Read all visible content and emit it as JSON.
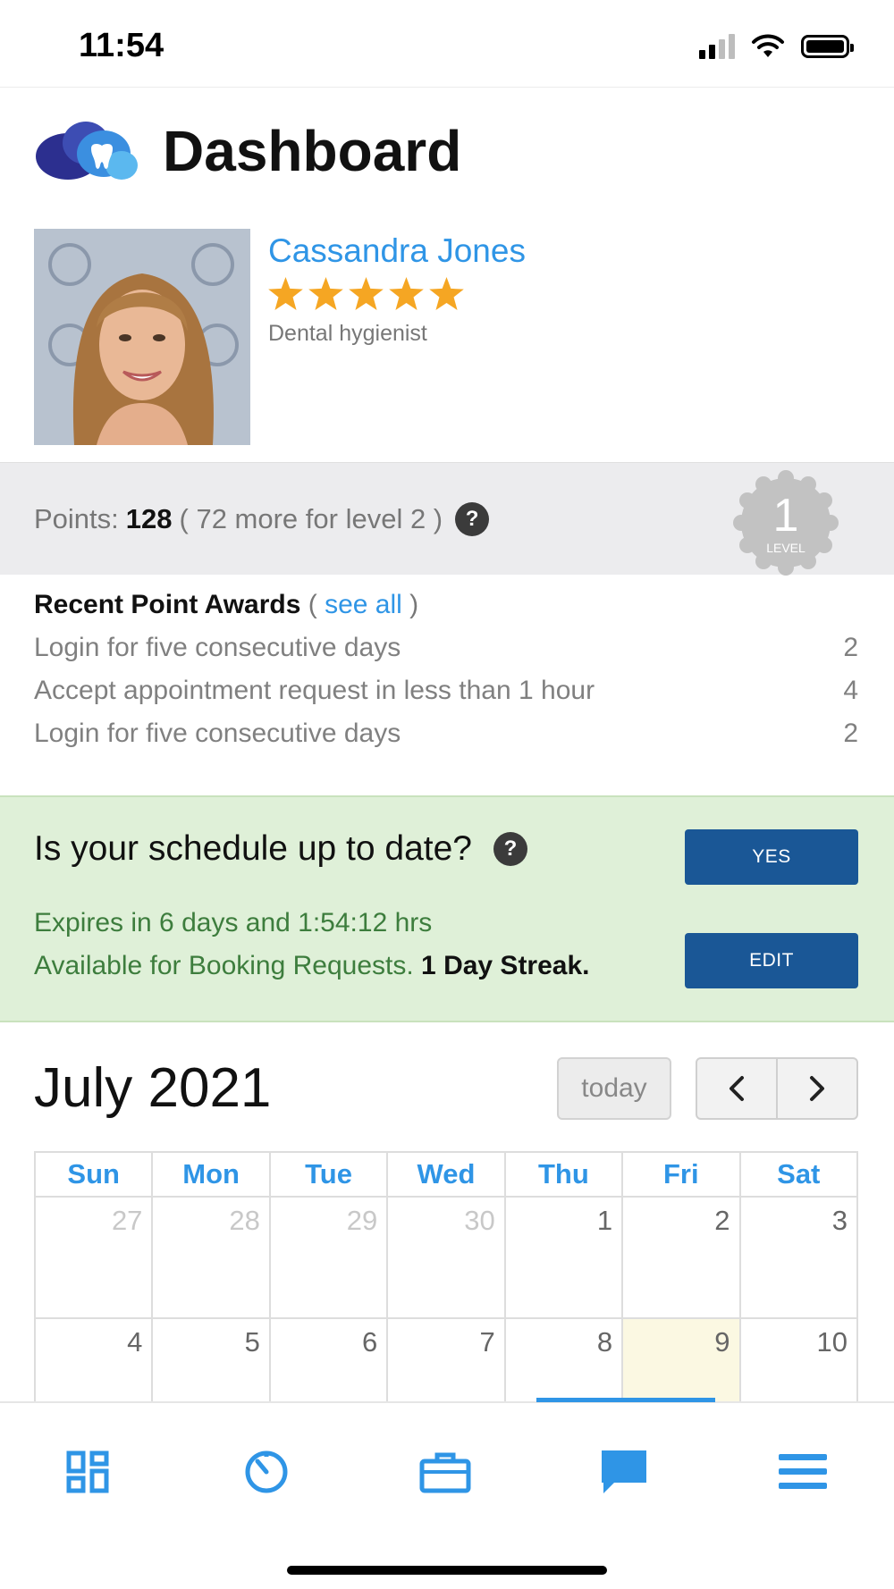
{
  "status_bar": {
    "time": "11:54"
  },
  "header": {
    "title": "Dashboard"
  },
  "profile": {
    "name": "Cassandra Jones",
    "rating": 5,
    "rating_max": 5,
    "role": "Dental hygienist"
  },
  "points": {
    "label": "Points:",
    "value": "128",
    "note": "( 72 more for level 2 )",
    "help": "?",
    "level_number": "1",
    "level_label": "LEVEL"
  },
  "awards": {
    "title": "Recent Point Awards",
    "see_all_open": "(",
    "see_all": "see all",
    "see_all_close": ")",
    "items": [
      {
        "label": "Login for five consecutive days",
        "points": "2"
      },
      {
        "label": "Accept appointment request in less than 1 hour",
        "points": "4"
      },
      {
        "label": "Login for five consecutive days",
        "points": "2"
      }
    ]
  },
  "schedule": {
    "question": "Is your schedule up to date?",
    "help": "?",
    "expires": "Expires in 6 days and 1:54:12 hrs",
    "available": "Available for Booking Requests.",
    "streak": "1 Day Streak.",
    "yes_label": "YES",
    "edit_label": "EDIT"
  },
  "calendar": {
    "month_title": "July 2021",
    "today_label": "today",
    "weekdays": [
      "Sun",
      "Mon",
      "Tue",
      "Wed",
      "Thu",
      "Fri",
      "Sat"
    ],
    "week1": [
      "27",
      "28",
      "29",
      "30",
      "1",
      "2",
      "3"
    ],
    "week2": [
      "4",
      "5",
      "6",
      "7",
      "8",
      "9",
      "10"
    ]
  },
  "tab_bar": {
    "items": [
      "dashboard-icon",
      "timer-icon",
      "briefcase-icon",
      "chat-icon",
      "menu-icon"
    ],
    "active": "chat-icon"
  },
  "colors": {
    "accent": "#2f95e6",
    "button_blue": "#1a5796",
    "star": "#f5a623",
    "success_bg": "#dff0d8",
    "success_text": "#3d7d3d",
    "today_bg": "#fbf8e2"
  }
}
